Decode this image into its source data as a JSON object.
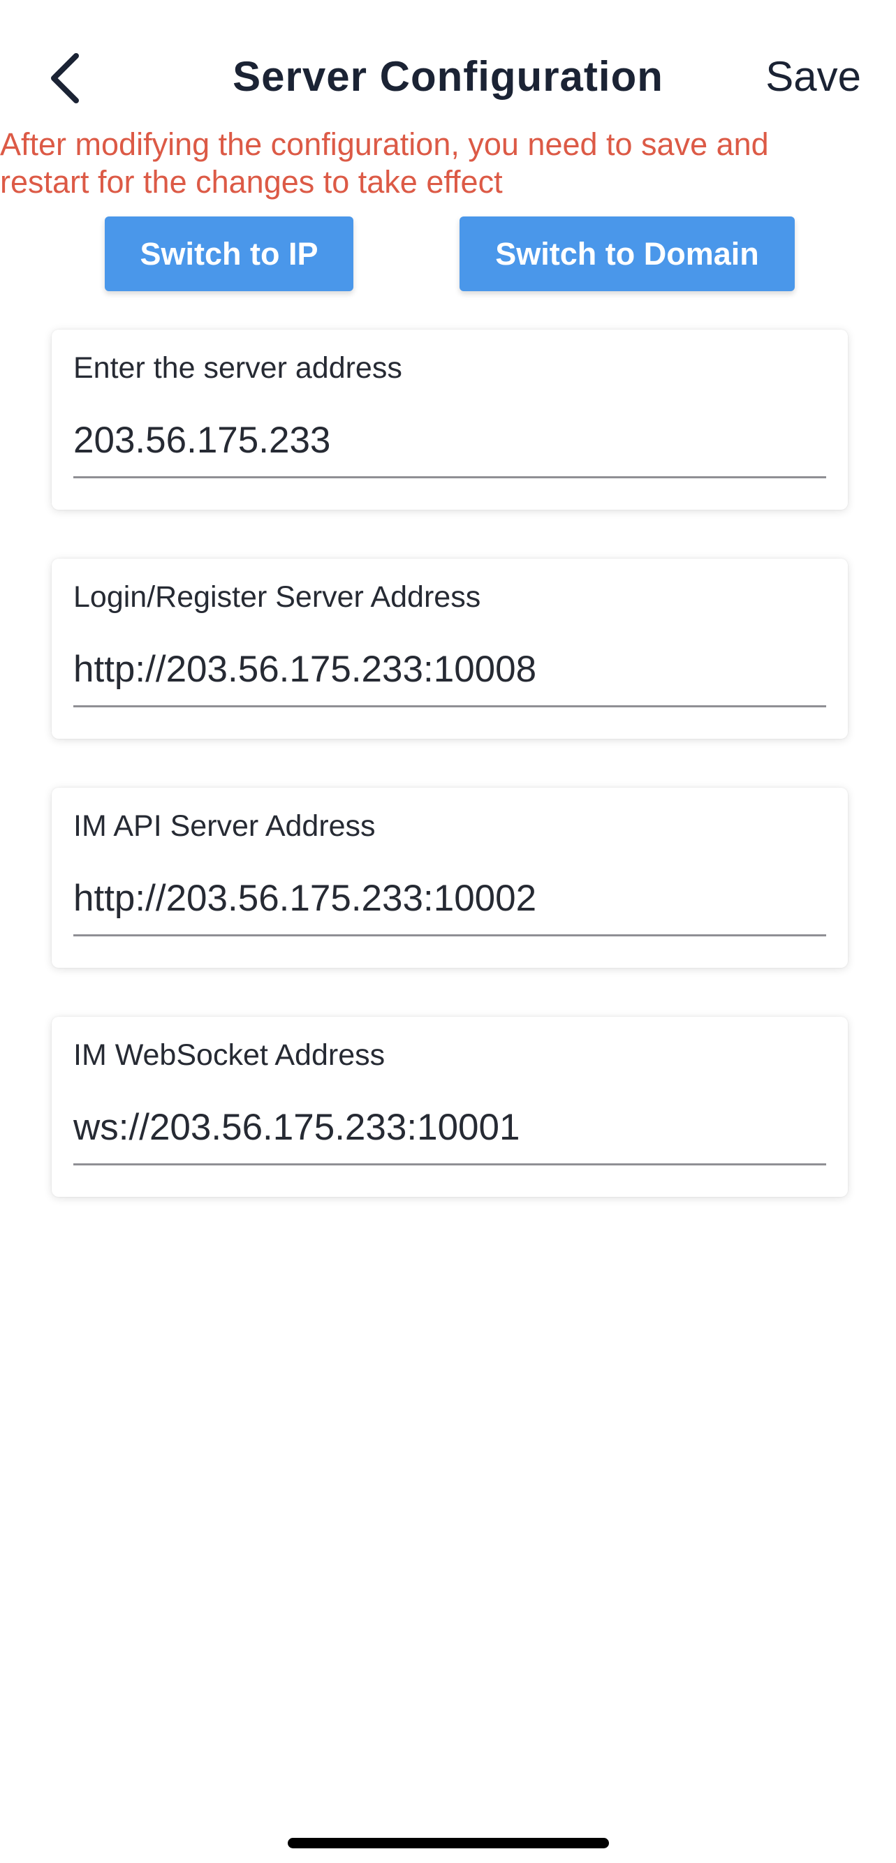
{
  "header": {
    "title": "Server Configuration",
    "save_label": "Save",
    "back_icon": "chevron-left-icon"
  },
  "warning": {
    "line1": "After modifying the configuration, you need to save and",
    "line2": "restart for the changes to take effect",
    "color": "#dc5a46"
  },
  "switches": {
    "ip_label": "Switch to IP",
    "domain_label": "Switch to Domain",
    "color": "#4a97ea"
  },
  "fields": [
    {
      "label": "Enter the server address",
      "value": "203.56.175.233"
    },
    {
      "label": "Login/Register Server Address",
      "value": "http://203.56.175.233:10008"
    },
    {
      "label": "IM API Server Address",
      "value": "http://203.56.175.233:10002"
    },
    {
      "label": "IM WebSocket Address",
      "value": "ws://203.56.175.233:10001"
    }
  ]
}
